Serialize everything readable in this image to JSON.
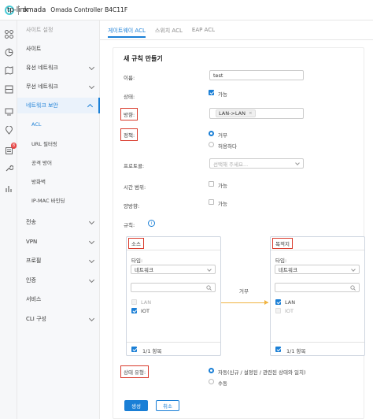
{
  "header": {
    "brand": "tp-link",
    "product": "omada",
    "title": "Omada Controller  B4C11F"
  },
  "rail": {
    "icons": [
      "grid-icon",
      "chart-icon",
      "map-icon",
      "devices-icon",
      "client-icon",
      "location-icon",
      "log-icon",
      "tools-icon",
      "stats-icon"
    ],
    "badge": "8"
  },
  "menu": {
    "items": [
      {
        "label": "사이트 설정",
        "muted": true
      },
      {
        "label": "사이트"
      },
      {
        "label": "유선 네트워크"
      },
      {
        "label": "무선 네트워크"
      },
      {
        "label": "네트워크 보안"
      },
      {
        "label": "ACL"
      },
      {
        "label": "URL 필터링"
      },
      {
        "label": "공격 방어"
      },
      {
        "label": "방화벽"
      },
      {
        "label": "IP-MAC 바인딩"
      },
      {
        "label": "전송"
      },
      {
        "label": "VPN"
      },
      {
        "label": "프로필"
      },
      {
        "label": "인증"
      },
      {
        "label": "서비스"
      },
      {
        "label": "CLI 구성"
      }
    ]
  },
  "tabs": [
    {
      "label": "게이트웨이 ACL"
    },
    {
      "label": "스위치 ACL"
    },
    {
      "label": "EAP ACL"
    }
  ],
  "form": {
    "title": "새 규칙 만들기",
    "name_label": "이름:",
    "name_value": "test",
    "status_label": "상태:",
    "status_option": "가능",
    "direction_label": "방향:",
    "direction_value": "LAN->LAN",
    "direction_remove": "×",
    "policy_label": "정책:",
    "policy_deny": "거부",
    "policy_allow": "허용하다",
    "protocol_label": "프로토콜:",
    "protocol_placeholder": "선택해 주세요...",
    "time_label": "시간 범위:",
    "time_option": "가능",
    "bidir_label": "양방향:",
    "bidir_option": "가능",
    "rules_label": "규칙:",
    "info_glyph": "i",
    "state_label": "상태 유형:",
    "state_auto": "자동(신규 / 설정된 / 관련된 상태와 일치)",
    "state_manual": "수동"
  },
  "source": {
    "title": "소스",
    "type_label": "타입:",
    "type_value": "네트워크",
    "items": [
      {
        "label": "LAN",
        "checked": false,
        "disabled": true
      },
      {
        "label": "IOT",
        "checked": true,
        "disabled": false
      }
    ],
    "footer": "1/1 항목"
  },
  "destination": {
    "title": "목적지",
    "type_label": "타입:",
    "type_value": "네트워크",
    "items": [
      {
        "label": "LAN",
        "checked": true,
        "disabled": false
      },
      {
        "label": "IOT",
        "checked": false,
        "disabled": true
      }
    ],
    "footer": "1/1 항목"
  },
  "transfer": {
    "label": "거부"
  },
  "buttons": {
    "create": "생성",
    "cancel": "취소"
  },
  "colors": {
    "accent": "#1a7fd6",
    "highlight": "#d93a2b",
    "arrow": "#f0b442",
    "badge": "#e64545"
  }
}
